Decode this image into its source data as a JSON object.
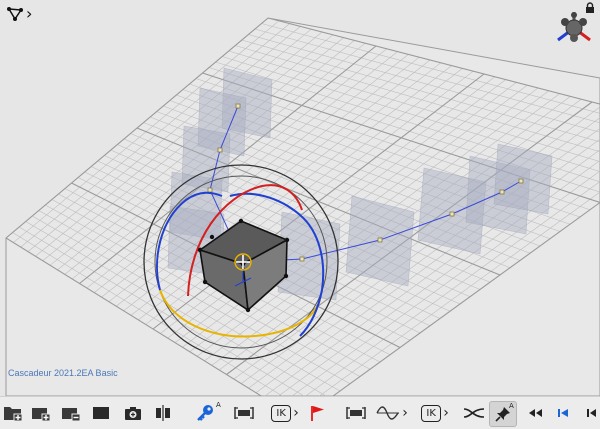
{
  "app": {
    "version_label": "Cascadeur 2021.2EA Basic"
  },
  "toolbar": {
    "ik_label_1": "IK",
    "ik_label_2": "IK",
    "superscript_a": "A",
    "buttons": [
      "add-scene-icon",
      "add-layer-icon",
      "remove-layer-icon",
      "frame-icon",
      "camera-add-icon",
      "split-icon",
      "key-icon",
      "interval-icon",
      "ik-icon",
      "flag-icon",
      "interval-icon",
      "curve-icon",
      "ik-icon",
      "path-icon",
      "pin-icon",
      "rewind-icon",
      "step-back-icon",
      "to-start-icon"
    ]
  },
  "colors": {
    "viewport_bg": "#e6e6e6",
    "grid": "#b8b8b8",
    "ring_red": "#d42020",
    "ring_blue": "#2040d0",
    "ring_yellow": "#e8b400",
    "accent_blue": "#1a66d6",
    "flag_red": "#e01818"
  }
}
